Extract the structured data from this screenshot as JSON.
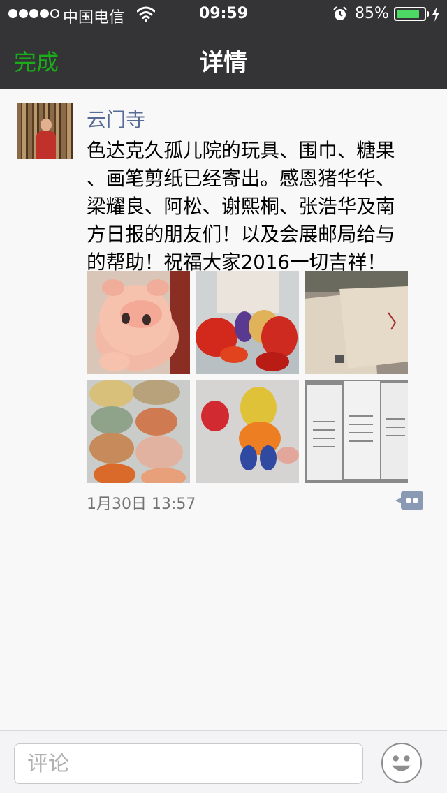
{
  "status_bar": {
    "carrier": "中国电信",
    "time": "09:59",
    "battery_percent": "85%",
    "battery_level": 0.85
  },
  "nav": {
    "back_label": "完成",
    "title": "详情"
  },
  "post": {
    "username": "云门寺",
    "text_lines": [
      "色达克久孤儿院的玩具、围巾、糖果",
      "、画笔剪纸已经寄出。感恩猪华华、",
      "梁耀良、阿松、谢熙桐、张浩华及南",
      "方日报的朋友们！以及会展邮局给与",
      "的帮助！祝福大家2016一切吉祥！"
    ],
    "timestamp": "1月30日 13:57"
  },
  "comment": {
    "placeholder": "评论"
  },
  "icons": [
    "signal-dots-icon",
    "wifi-icon",
    "alarm-icon",
    "battery-icon",
    "charging-icon",
    "comment-icon",
    "smiley-icon"
  ],
  "colors": {
    "header_bg": "#343436",
    "accent_green": "#1aad19",
    "username_blue": "#576b95",
    "battery_green": "#4cd964"
  }
}
